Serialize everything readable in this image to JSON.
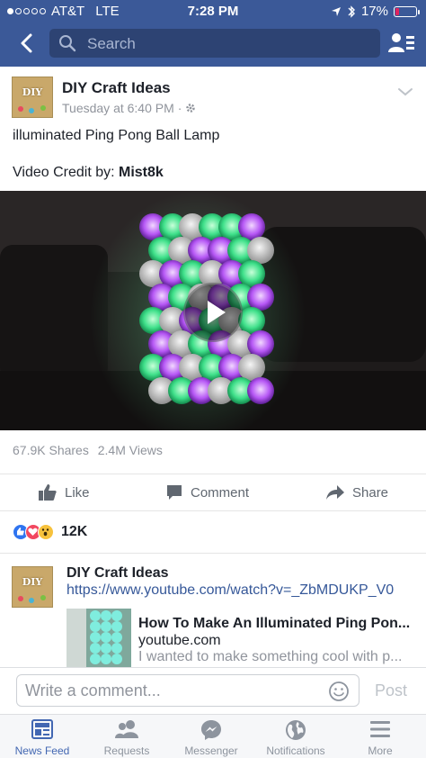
{
  "status_bar": {
    "carrier": "AT&T",
    "network": "LTE",
    "time": "7:28 PM",
    "battery": "17%"
  },
  "nav": {
    "search_placeholder": "Search"
  },
  "post": {
    "page_name": "DIY Craft Ideas",
    "avatar_text": "DIY",
    "timestamp": "Tuesday at 6:40 PM",
    "separator": "·",
    "text": "illuminated Ping Pong Ball Lamp",
    "credit_prefix": "Video Credit by: ",
    "credit_name": "Mist8k",
    "shares": "67.9K Shares",
    "views": "2.4M Views",
    "actions": {
      "like": "Like",
      "comment": "Comment",
      "share": "Share"
    },
    "reaction_count": "12K"
  },
  "comment_preview": {
    "name": "DIY Craft Ideas",
    "avatar_text": "DIY",
    "link": "https://www.youtube.com/watch?v=_ZbMDUKP_V0",
    "preview_title": "How To Make An Illuminated Ping Pon...",
    "preview_domain": "youtube.com",
    "preview_desc": "I wanted to make something cool with p..."
  },
  "comment_bar": {
    "placeholder": "Write a comment...",
    "post_label": "Post"
  },
  "tabs": [
    {
      "label": "News Feed",
      "icon": "news-feed-icon",
      "active": true
    },
    {
      "label": "Requests",
      "icon": "requests-icon",
      "active": false
    },
    {
      "label": "Messenger",
      "icon": "messenger-icon",
      "active": false
    },
    {
      "label": "Notifications",
      "icon": "globe-icon",
      "active": false
    },
    {
      "label": "More",
      "icon": "menu-icon",
      "active": false
    }
  ],
  "colors": {
    "brand": "#3b5998",
    "link": "#365899",
    "active_tab": "#4267b2"
  }
}
